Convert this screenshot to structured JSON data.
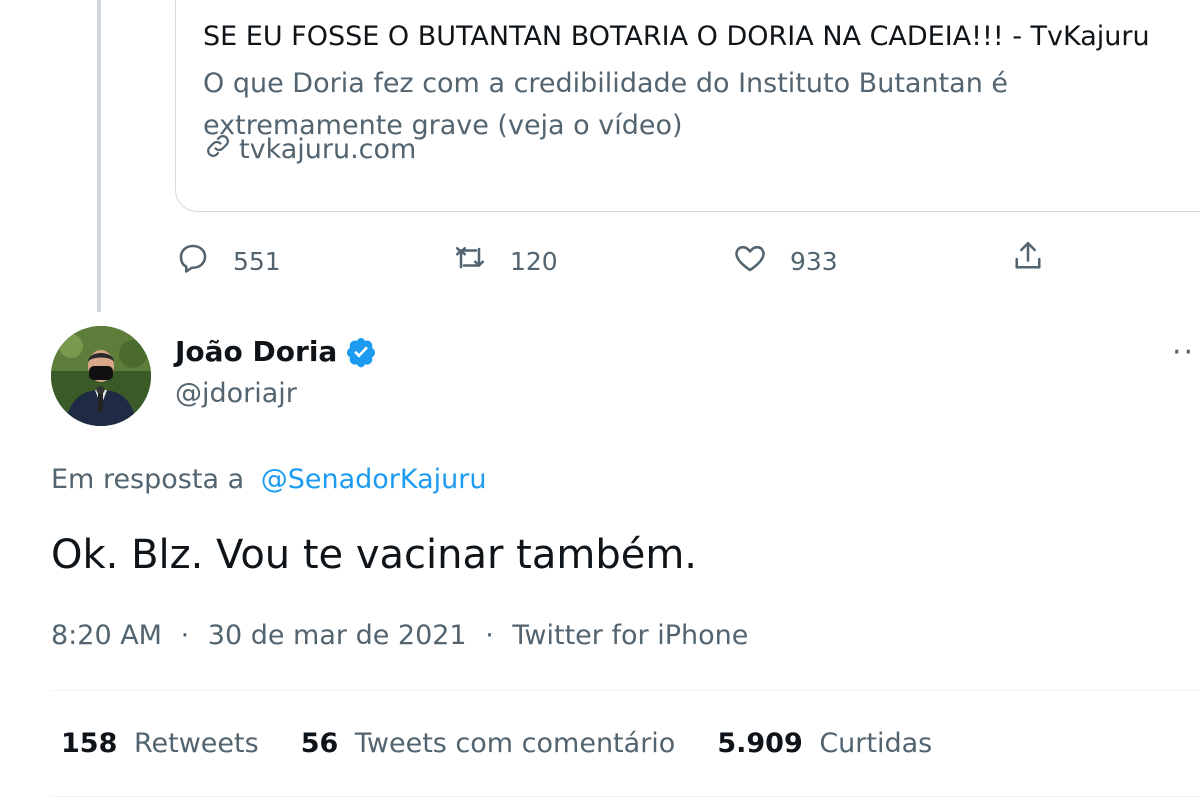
{
  "link_card": {
    "title": "SE EU FOSSE O BUTANTAN BOTARIA O DORIA NA CADEIA!!! - TvKajuru",
    "description": "O que Doria fez com a credibilidade do Instituto Butantan é extremamente grave (veja o vídeo)",
    "domain": "tvkajuru.com",
    "icon": "link-icon"
  },
  "actions": {
    "reply_count": "551",
    "retweet_count": "120",
    "like_count": "933"
  },
  "author": {
    "name": "João Doria",
    "handle": "@jdoriajr",
    "verified": true
  },
  "reply_to": {
    "prefix": "Em resposta a",
    "mention": "@SenadorKajuru"
  },
  "tweet": {
    "text": "Ok. Blz. Vou te vacinar também.",
    "time": "8:20 AM",
    "separator": "·",
    "date": "30 de mar de 2021",
    "source": "Twitter for iPhone"
  },
  "stats": {
    "retweets_count": "158",
    "retweets_label": "Retweets",
    "quotes_count": "56",
    "quotes_label": "Tweets com comentário",
    "likes_count": "5.909",
    "likes_label": "Curtidas"
  },
  "colors": {
    "accent": "#1d9bf0",
    "secondary_text": "#536471",
    "primary_text": "#0f1419",
    "border": "#cfd9de"
  }
}
